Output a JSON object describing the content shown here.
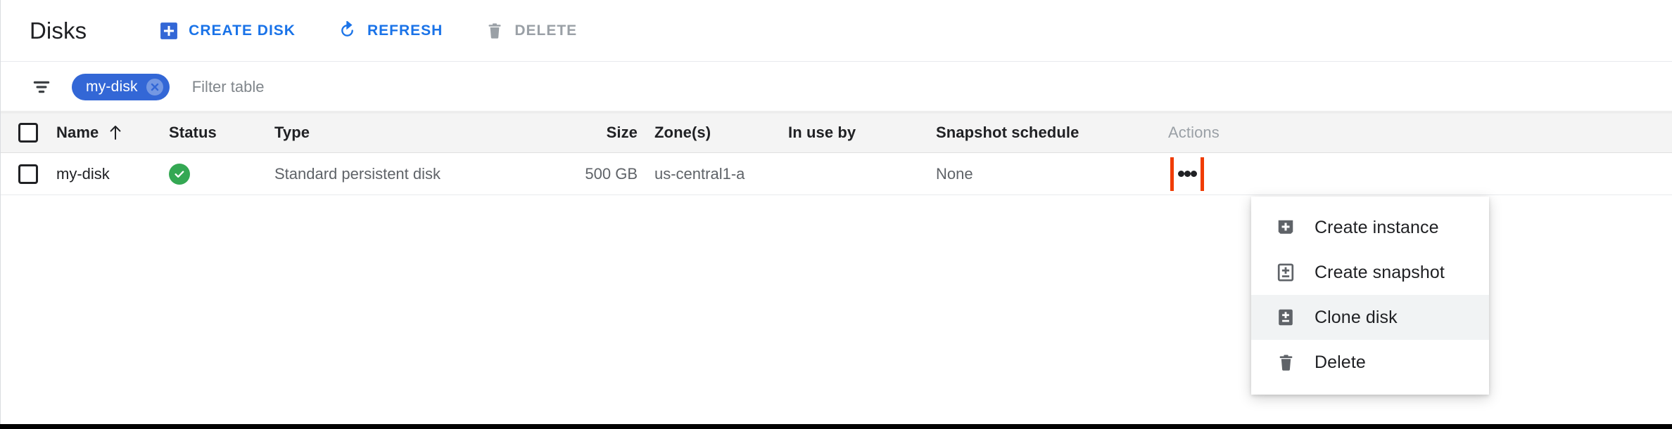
{
  "header": {
    "title": "Disks",
    "buttons": [
      {
        "label": "Create disk",
        "icon": "create-disk-icon",
        "state": "enabled"
      },
      {
        "label": "Refresh",
        "icon": "refresh-icon",
        "state": "enabled"
      },
      {
        "label": "Delete",
        "icon": "trash-icon",
        "state": "disabled"
      }
    ]
  },
  "filter": {
    "icon": "filter-list-icon",
    "chip": {
      "label": "my-disk",
      "remove_icon": "chip-close-icon"
    },
    "placeholder": "Filter table",
    "value": ""
  },
  "table": {
    "columns": [
      {
        "key": "checkbox",
        "label": ""
      },
      {
        "key": "name",
        "label": "Name",
        "sort": "asc",
        "sort_icon": "arrow-up-icon"
      },
      {
        "key": "status",
        "label": "Status"
      },
      {
        "key": "type",
        "label": "Type"
      },
      {
        "key": "size",
        "label": "Size"
      },
      {
        "key": "zone",
        "label": "Zone(s)"
      },
      {
        "key": "in_use_by",
        "label": "In use by"
      },
      {
        "key": "snapshot_schedule",
        "label": "Snapshot schedule"
      },
      {
        "key": "actions",
        "label": "Actions"
      }
    ],
    "rows": [
      {
        "selected": false,
        "name": "my-disk",
        "status": "ok",
        "status_icon": "check-circle-icon",
        "type": "Standard persistent disk",
        "size": "500 GB",
        "zone": "us-central1-a",
        "in_use_by": "",
        "snapshot_schedule": "None",
        "actions_icon": "more-vert-icon"
      }
    ]
  },
  "actions_menu": {
    "open": true,
    "items": [
      {
        "label": "Create instance",
        "icon": "create-instance-icon",
        "hover": false
      },
      {
        "label": "Create snapshot",
        "icon": "create-snapshot-icon",
        "hover": false
      },
      {
        "label": "Clone disk",
        "icon": "clone-disk-icon",
        "hover": true
      },
      {
        "label": "Delete",
        "icon": "trash-icon",
        "hover": false
      }
    ]
  },
  "colors": {
    "accent_blue": "#1a73e8",
    "chip_blue": "#3367d6",
    "status_green": "#34a853",
    "disabled_grey": "#9aa0a6",
    "highlight_red": "#f03c02",
    "header_bg": "#f4f4f4"
  }
}
